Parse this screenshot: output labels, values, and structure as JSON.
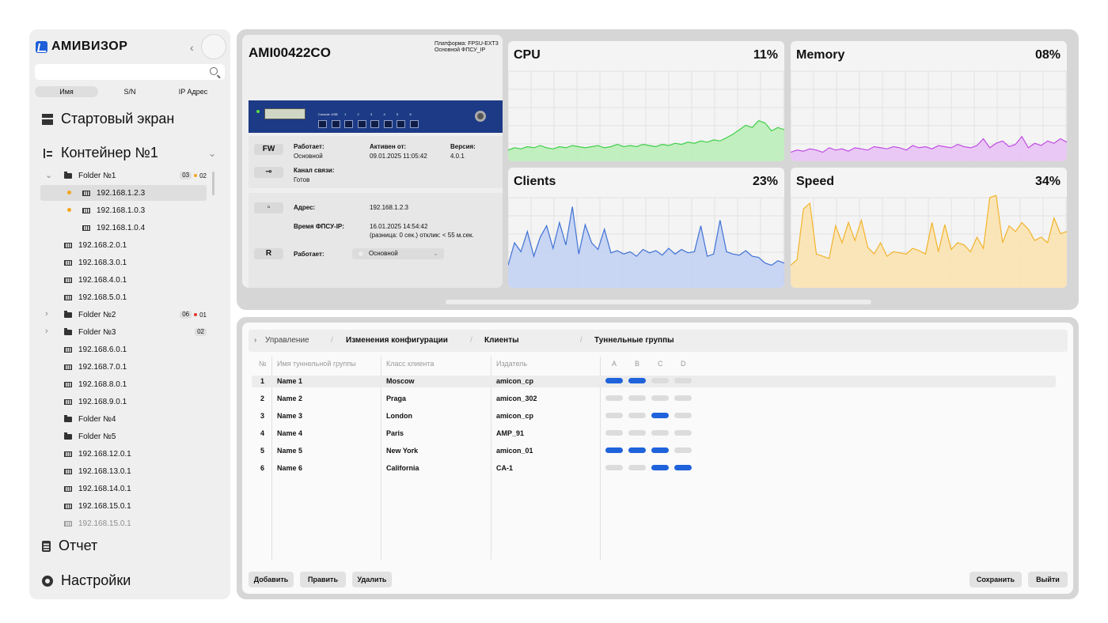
{
  "brand": {
    "name": "АМИВИЗОР",
    "accent": "#1f5fd8"
  },
  "sidebar": {
    "search_placeholder": "",
    "filters": [
      "Имя",
      "S/N",
      "IP Адрес"
    ],
    "nav": {
      "home": "Стартовый экран",
      "container": "Контейнер №1",
      "report": "Отчет",
      "settings": "Настройки"
    },
    "tree": [
      {
        "label": "Folder №1",
        "type": "folder",
        "indent": 1,
        "badge1": "03",
        "badge2": "02",
        "expanded": true
      },
      {
        "label": "192.168.1.2.3",
        "type": "device",
        "indent": 2,
        "warn": true,
        "selected": true
      },
      {
        "label": "192.168.1.0.3",
        "type": "device",
        "indent": 2,
        "warn": true
      },
      {
        "label": "192.168.1.0.4",
        "type": "device",
        "indent": 2
      },
      {
        "label": "192.168.2.0.1",
        "type": "device",
        "indent": 1
      },
      {
        "label": "192.168.3.0.1",
        "type": "device",
        "indent": 1
      },
      {
        "label": "192.168.4.0.1",
        "type": "device",
        "indent": 1
      },
      {
        "label": "192.168.5.0.1",
        "type": "device",
        "indent": 1
      },
      {
        "label": "Folder №2",
        "type": "folder",
        "indent": 1,
        "badge1": "06",
        "badge2": "01",
        "collapsed": true
      },
      {
        "label": "Folder №3",
        "type": "folder",
        "indent": 1,
        "badge1": "02",
        "collapsed": true
      },
      {
        "label": "192.168.6.0.1",
        "type": "device",
        "indent": 1
      },
      {
        "label": "192.168.7.0.1",
        "type": "device",
        "indent": 1
      },
      {
        "label": "192.168.8.0.1",
        "type": "device",
        "indent": 1
      },
      {
        "label": "192.168.9.0.1",
        "type": "device",
        "indent": 1
      },
      {
        "label": "Folder №4",
        "type": "folder",
        "indent": 1
      },
      {
        "label": "Folder №5",
        "type": "folder",
        "indent": 1
      },
      {
        "label": "192.168.12.0.1",
        "type": "device",
        "indent": 1
      },
      {
        "label": "192.168.13.0.1",
        "type": "device",
        "indent": 1
      },
      {
        "label": "192.168.14.0.1",
        "type": "device",
        "indent": 1
      },
      {
        "label": "192.168.15.0.1",
        "type": "device",
        "indent": 1
      },
      {
        "label": "192.168.15.0.1",
        "type": "device",
        "indent": 1,
        "faded": true
      }
    ]
  },
  "device": {
    "title": "AMI00422CO",
    "platform_line1": "Платформа: FPSU-EXT3",
    "platform_line2": "Основной ФПСУ_IP",
    "fw_tag": "FW",
    "works_label": "Работает:",
    "works_value": "Основной",
    "active_label": "Активен от:",
    "active_value": "09.01.2025 11:05:42",
    "version_label": "Версия:",
    "version_value": "4.0.1",
    "channel_label": "Канал связи:",
    "channel_value": "Готов",
    "address_label": "Адрес:",
    "address_value": "192.168.1.2.3",
    "time_label": "Время ФПСУ-IP:",
    "time_value": "16.01.2025 14:54:42",
    "time_note": "(разница: 0 сек.) отклик: < 55 м.сек.",
    "r_tag": "R",
    "r_works_label": "Работает:",
    "r_mode": "Основной",
    "port_labels": [
      "Console",
      "USB",
      "1",
      "2",
      "3",
      "4",
      "5",
      "6"
    ]
  },
  "metrics": [
    {
      "title": "CPU",
      "percent": "11%",
      "color": "#3fcf4a",
      "fill": "#bdeeb9",
      "values": [
        10,
        12,
        11,
        13,
        12,
        14,
        12,
        11,
        13,
        12,
        14,
        13,
        12,
        13,
        14,
        12,
        13,
        15,
        13,
        14,
        13,
        15,
        14,
        13,
        15,
        14,
        16,
        15,
        17,
        16,
        18,
        17,
        19,
        18,
        21,
        24,
        28,
        32,
        30,
        36,
        34,
        27,
        30,
        28
      ]
    },
    {
      "title": "Memory",
      "percent": "08%",
      "color": "#c04ee3",
      "fill": "#e9c3f5",
      "values": [
        8,
        10,
        9,
        11,
        10,
        8,
        12,
        10,
        11,
        9,
        12,
        11,
        10,
        13,
        12,
        11,
        13,
        12,
        10,
        14,
        12,
        13,
        11,
        14,
        13,
        12,
        15,
        13,
        12,
        14,
        20,
        12,
        16,
        18,
        13,
        15,
        22,
        12,
        16,
        14,
        18,
        16,
        20,
        17
      ]
    },
    {
      "title": "Clients",
      "percent": "23%",
      "color": "#3f72d4",
      "fill": "#c3d2f3",
      "values": [
        20,
        40,
        32,
        50,
        28,
        45,
        55,
        35,
        58,
        38,
        72,
        30,
        56,
        40,
        34,
        52,
        31,
        33,
        30,
        32,
        28,
        34,
        31,
        33,
        29,
        35,
        30,
        34,
        31,
        32,
        55,
        28,
        30,
        60,
        32,
        30,
        29,
        33,
        28,
        27,
        22,
        20,
        24,
        22
      ]
    },
    {
      "title": "Speed",
      "percent": "34%",
      "color": "#f2b42c",
      "fill": "#fbe3b3",
      "values": [
        20,
        25,
        70,
        75,
        30,
        28,
        26,
        55,
        40,
        58,
        42,
        60,
        36,
        30,
        40,
        28,
        32,
        31,
        30,
        35,
        33,
        30,
        58,
        32,
        56,
        34,
        40,
        38,
        32,
        45,
        35,
        80,
        82,
        40,
        55,
        50,
        58,
        52,
        42,
        45,
        40,
        62,
        48,
        50
      ]
    }
  ],
  "tabs": [
    "Управление",
    "Изменения конфигурации",
    "Клиенты",
    "Туннельные группы"
  ],
  "table": {
    "headers": [
      "№",
      "Имя туннельной группы",
      "Класс клиента",
      "Издатель",
      "A",
      "B",
      "C",
      "D"
    ],
    "rows": [
      {
        "n": "1",
        "name": "Name 1",
        "cls": "Moscow",
        "pub": "amicon_cp",
        "flags": [
          1,
          1,
          0,
          0
        ]
      },
      {
        "n": "2",
        "name": "Name 2",
        "cls": "Praga",
        "pub": "amicon_302",
        "flags": [
          0,
          0,
          0,
          0
        ]
      },
      {
        "n": "3",
        "name": "Name 3",
        "cls": "London",
        "pub": "amicon_cp",
        "flags": [
          0,
          0,
          1,
          0
        ]
      },
      {
        "n": "4",
        "name": "Name 4",
        "cls": "Paris",
        "pub": "AMP_91",
        "flags": [
          0,
          0,
          0,
          0
        ]
      },
      {
        "n": "5",
        "name": "Name 5",
        "cls": "New York",
        "pub": "amicon_01",
        "flags": [
          1,
          1,
          1,
          0
        ]
      },
      {
        "n": "6",
        "name": "Name 6",
        "cls": "California",
        "pub": "CA-1",
        "flags": [
          0,
          0,
          1,
          1
        ]
      }
    ]
  },
  "buttons": {
    "add": "Добавить",
    "edit": "Править",
    "delete": "Удалить",
    "save": "Сохранить",
    "exit": "Выйти"
  }
}
